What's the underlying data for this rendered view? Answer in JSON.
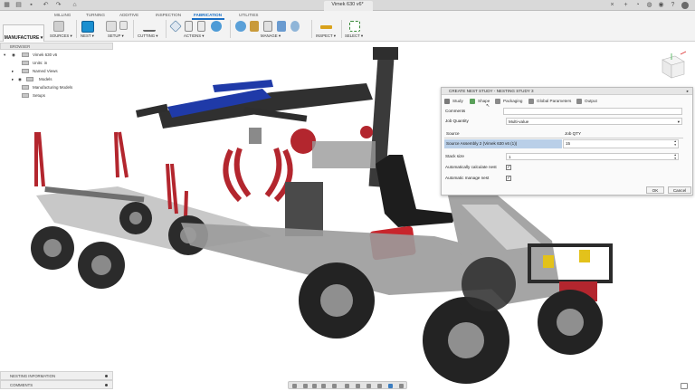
{
  "window": {
    "doc_title": "Vimek 630 v6*"
  },
  "ribbon": {
    "workspace": "MANUFACTURE",
    "tabs": [
      "MILLING",
      "TURNING",
      "ADDITIVE",
      "INSPECTION",
      "FABRICATION",
      "UTILITIES"
    ],
    "active_tab": "FABRICATION",
    "groups": [
      {
        "label": "SOURCES ▾"
      },
      {
        "label": "NEST ▾"
      },
      {
        "label": "SETUP ▾"
      },
      {
        "label": "CUTTING ▾"
      },
      {
        "label": "ACTIONS ▾"
      },
      {
        "label": "MANAGE ▾"
      },
      {
        "label": "INSPECT ▾"
      },
      {
        "label": "SELECT ▾"
      }
    ]
  },
  "browser": {
    "title": "BROWSER",
    "items": [
      {
        "label": "Vimek 630 v6"
      },
      {
        "label": "Units: in"
      },
      {
        "label": "Named Views"
      },
      {
        "label": "Models"
      },
      {
        "label": "Manufacturing Models"
      },
      {
        "label": "Setups"
      }
    ]
  },
  "dialog": {
    "title": "CREATE NEST STUDY - NESTING STUDY 3",
    "tabs": [
      {
        "label": "Study",
        "color": "#7a7a7a"
      },
      {
        "label": "Shape",
        "color": "#5aa05a"
      },
      {
        "label": "Packaging",
        "color": "#8a8a8a"
      },
      {
        "label": "Global Parameters",
        "color": "#8a8a8a"
      },
      {
        "label": "Output",
        "color": "#8a8a8a"
      }
    ],
    "comments_label": "Comments",
    "job_quantity_label": "Job Quantity",
    "job_quantity_value": "Multi-value",
    "source_header": "Source",
    "job_qty_header": "Job QTY",
    "source_row": "Source Assembly 2 (Vimek 630 v6 (1))",
    "source_qty": "15",
    "stack_size_label": "Stack size",
    "stack_size_value": "1",
    "auto_calc_label": "Automatically calculate nest",
    "auto_manage_label": "Automatic manage nest",
    "ok_label": "OK",
    "cancel_label": "Cancel"
  },
  "bottom": {
    "nesting_info": "NESTING INFORMATION",
    "comments": "COMMENTS"
  },
  "colors": {
    "accent": "#1a6fc4",
    "frame_red": "#b3262e",
    "arm_blue": "#1f3aa8",
    "body_gray": "#8f8f8f"
  }
}
